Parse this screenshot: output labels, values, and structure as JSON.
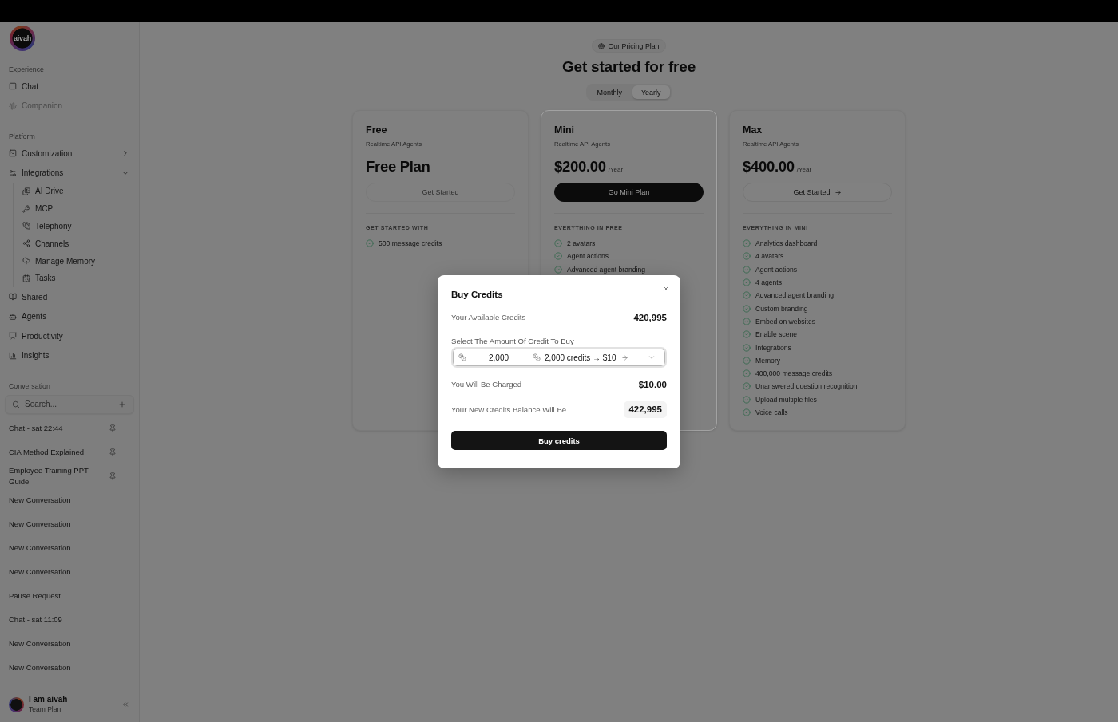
{
  "sidebar": {
    "logo": "aivah",
    "sections": [
      {
        "title": "Experience",
        "items": [
          {
            "label": "Chat",
            "kind": "link",
            "disabled": false
          },
          {
            "label": "Companion",
            "kind": "link",
            "disabled": true
          }
        ]
      },
      {
        "title": "Platform",
        "items": [
          {
            "label": "Customization",
            "kind": "group",
            "disabled": false,
            "expanded": false
          },
          {
            "label": "Integrations",
            "kind": "group",
            "disabled": false,
            "expanded": true,
            "children": [
              {
                "label": "AI Drive"
              },
              {
                "label": "MCP"
              },
              {
                "label": "Telephony"
              },
              {
                "label": "Channels"
              },
              {
                "label": "Manage Memory"
              },
              {
                "label": "Tasks"
              }
            ]
          },
          {
            "label": "Shared",
            "kind": "link",
            "disabled": false
          },
          {
            "label": "Agents",
            "kind": "link",
            "disabled": false
          },
          {
            "label": "Productivity",
            "kind": "link",
            "disabled": false
          },
          {
            "label": "Insights",
            "kind": "link",
            "disabled": false
          }
        ]
      }
    ],
    "conversations": {
      "title": "Conversation",
      "search": {
        "placeholder": "Search..."
      },
      "items": [
        {
          "title": "Chat - sat 22:44",
          "pinned": true
        },
        {
          "title": "CIA Method Explained",
          "pinned": true
        },
        {
          "title": "Employee Training PPT Guide",
          "pinned": true
        },
        {
          "title": "New Conversation",
          "pinned": false
        },
        {
          "title": "New Conversation",
          "pinned": false
        },
        {
          "title": "New Conversation",
          "pinned": false
        },
        {
          "title": "New Conversation",
          "pinned": false
        },
        {
          "title": "Pause Request",
          "pinned": false
        },
        {
          "title": "Chat - sat 11:09",
          "pinned": false
        },
        {
          "title": "New Conversation",
          "pinned": false
        },
        {
          "title": "New Conversation",
          "pinned": false
        }
      ]
    },
    "user": {
      "name": "I am aivah",
      "plan": "Team Plan"
    }
  },
  "pricing": {
    "badge": "Our Pricing Plan",
    "title": "Get started for free",
    "billing_tabs": [
      {
        "label": "Monthly",
        "selected": false
      },
      {
        "label": "Yearly",
        "selected": true
      }
    ],
    "plans": [
      {
        "name": "Free",
        "subtitle": "Realtime API Agents",
        "price": "Free Plan",
        "highlighted": false,
        "button": {
          "label": "Get Started",
          "kind": "disabled"
        },
        "features_heading": "GET STARTED WITH",
        "features": [
          "500 message credits"
        ]
      },
      {
        "name": "Mini",
        "subtitle": "Realtime API Agents",
        "price": "$200.00",
        "period": "/Year",
        "highlighted": true,
        "button": {
          "label": "Go Mini Plan",
          "kind": "primary"
        },
        "features_heading": "EVERYTHING IN FREE",
        "features": [
          "2 avatars",
          "Agent actions",
          "Advanced agent branding"
        ]
      },
      {
        "name": "Max",
        "subtitle": "Realtime API Agents",
        "price": "$400.00",
        "period": "/Year",
        "highlighted": false,
        "button": {
          "label": "Get Started",
          "kind": "outline"
        },
        "features_heading": "EVERYTHING IN MINI",
        "features": [
          "Analytics dashboard",
          "4 avatars",
          "Agent actions",
          "4 agents",
          "Advanced agent branding",
          "Custom branding",
          "Embed on websites",
          "Enable scene",
          "Integrations",
          "Memory",
          "400,000 message credits",
          "Unanswered question recognition",
          "Upload multiple files",
          "Voice calls"
        ]
      }
    ]
  },
  "modal": {
    "title": "Buy Credits",
    "available": {
      "label": "Your Available Credits",
      "value": "420,995"
    },
    "amount": {
      "label": "Select The Amount Of Credit To Buy",
      "value": "2,000",
      "option": "2,000 credits → $10"
    },
    "charge": {
      "label": "You Will Be Charged",
      "value": "$10.00"
    },
    "new_balance": {
      "label": "Your New Credits Balance Will Be",
      "value": "422,995"
    },
    "button": "Buy credits"
  }
}
